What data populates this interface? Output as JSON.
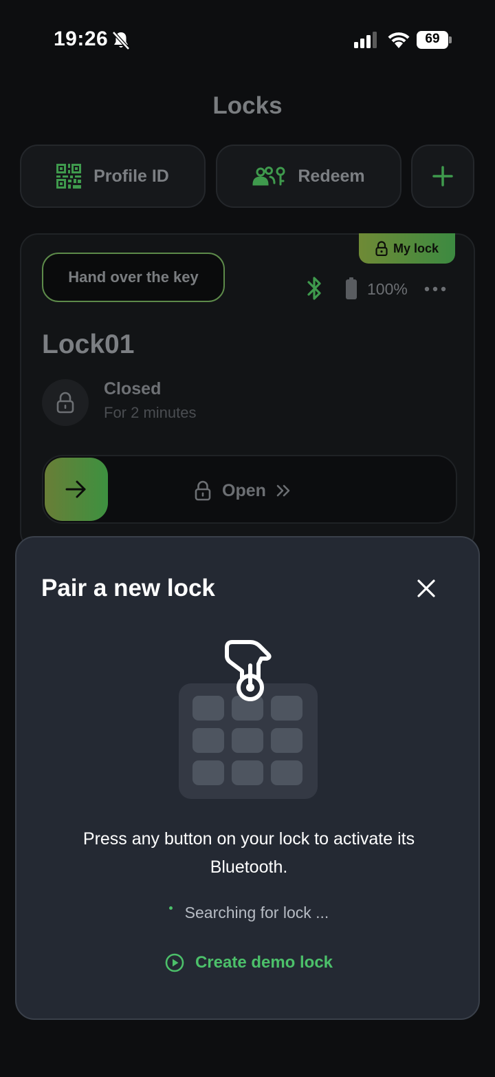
{
  "status_bar": {
    "time": "19:26",
    "battery": "69"
  },
  "header": {
    "title": "Locks"
  },
  "actions": {
    "profile_id_label": "Profile ID",
    "redeem_label": "Redeem"
  },
  "lock_card": {
    "badge_label": "My lock",
    "handover_label": "Hand over the key",
    "battery_percent": "100%",
    "name": "Lock01",
    "state_title": "Closed",
    "state_subtitle": "For 2 minutes",
    "slide_label": "Open"
  },
  "sheet": {
    "title": "Pair a new lock",
    "description": "Press any button on your lock to activate its Bluetooth.",
    "searching_text": "Searching for lock ...",
    "demo_label": "Create demo lock"
  },
  "colors": {
    "accent_green": "#4cc06a",
    "sheet_bg": "#242933",
    "page_bg": "#0d0e10"
  }
}
